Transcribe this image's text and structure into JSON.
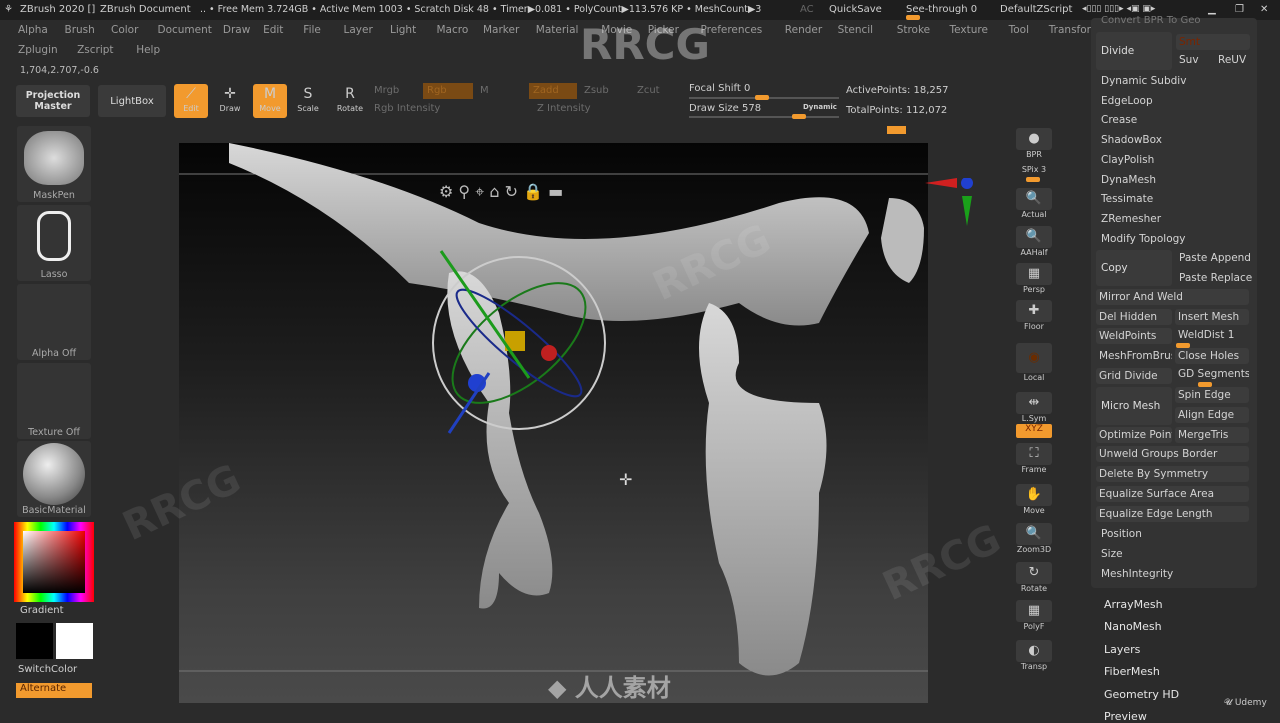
{
  "titlebar": {
    "app": "ZBrush 2020 []",
    "doc": "ZBrush Document",
    "stats": ".. • Free Mem 3.724GB • Active Mem 1003 • Scratch Disk 48 • Timer▶0.081 • PolyCount▶113.576 KP • MeshCount▶3",
    "ac": "AC",
    "quicksave": "QuickSave",
    "seethrough": "See-through  0",
    "script": "DefaultZScript"
  },
  "menu1": [
    "Alpha",
    "Brush",
    "Color",
    "Document",
    "Draw",
    "Edit",
    "File",
    "Layer",
    "Light",
    "Macro",
    "Marker",
    "Material",
    "Movie",
    "Picker",
    "Preferences",
    "Render",
    "Stencil",
    "Stroke",
    "Texture",
    "Tool",
    "Transform"
  ],
  "menu2": [
    "Zplugin",
    "Zscript",
    "Help"
  ],
  "coords": "1,704,2.707,-0.6",
  "topshelf": {
    "projection": "Projection Master",
    "lightbox": "LightBox",
    "edit": "Edit",
    "draw": "Draw",
    "move": "Move",
    "scale": "Scale",
    "rotate": "Rotate",
    "mrgb": "Mrgb",
    "rgb": "Rgb",
    "m": "M",
    "rgb_intensity": "Rgb Intensity",
    "zadd": "Zadd",
    "zsub": "Zsub",
    "zcut": "Zcut",
    "z_intensity": "Z Intensity",
    "focal_shift": "Focal Shift 0",
    "draw_size": "Draw Size 578",
    "dynamic": "Dynamic",
    "active_points": "ActivePoints: 18,257",
    "total_points": "TotalPoints: 112,072"
  },
  "leftshelf": {
    "brush": "MaskPen",
    "stroke": "Lasso",
    "alpha": "Alpha Off",
    "texture": "Texture Off",
    "material": "BasicMaterial",
    "gradient": "Gradient",
    "switch": "SwitchColor",
    "alternate": "Alternate"
  },
  "rightshelf": [
    "BPR",
    "SPix 3",
    "Actual",
    "AAHalf",
    "Persp",
    "Floor",
    "Local",
    "L.Sym",
    "XYZ",
    "Frame",
    "Move",
    "Zoom3D",
    "Rotate",
    "PolyF",
    "Transp"
  ],
  "panel": {
    "header": "Convert BPR To Geo",
    "divide": "Divide",
    "smt": "Smt",
    "suv": "Suv",
    "reuv": "ReUV",
    "items": [
      "Dynamic Subdiv",
      "EdgeLoop",
      "Crease",
      "ShadowBox",
      "ClayPolish",
      "DynaMesh",
      "Tessimate",
      "ZRemesher"
    ],
    "modify": "Modify Topology",
    "copy": "Copy",
    "paste_append": "Paste Append",
    "paste_replace": "Paste Replace",
    "mirror": "Mirror And Weld",
    "del_hidden": "Del Hidden",
    "insert_mesh": "Insert Mesh",
    "weldpoints": "WeldPoints",
    "welddist": "WeldDist 1",
    "meshfrombrush": "MeshFromBrush",
    "close_holes": "Close Holes",
    "grid_divide": "Grid Divide",
    "gd_segments": "GD Segments",
    "micro_mesh": "Micro Mesh",
    "spin_edge": "Spin Edge",
    "align_edge": "Align Edge",
    "optimize": "Optimize Points",
    "mergetris": "MergeTris",
    "unweld": "Unweld Groups Border",
    "del_sym": "Delete By Symmetry",
    "eq_surface": "Equalize Surface Area",
    "eq_edge": "Equalize Edge Length",
    "position": "Position",
    "size": "Size",
    "integrity": "MeshIntegrity"
  },
  "subpalettes": [
    "ArrayMesh",
    "NanoMesh",
    "Layers",
    "FiberMesh",
    "Geometry HD",
    "Preview"
  ],
  "watermark": "RRCG 人人素材",
  "udemy": "Udemy",
  "colors": {
    "accent": "#f29a2e"
  }
}
